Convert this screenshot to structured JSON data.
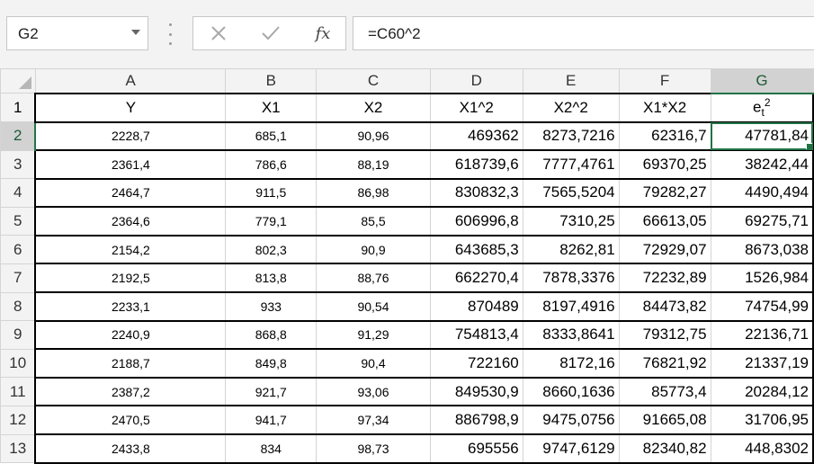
{
  "formula_bar": {
    "name_box": "G2",
    "formula": "=C60^2",
    "cancel_icon": "close-icon",
    "enter_icon": "check-icon",
    "fx_label": "fx"
  },
  "columns": [
    "A",
    "B",
    "C",
    "D",
    "E",
    "F",
    "G"
  ],
  "selected_column": "G",
  "selected_row": "2",
  "row_numbers": [
    "1",
    "2",
    "3",
    "4",
    "5",
    "6",
    "7",
    "8",
    "9",
    "10",
    "11",
    "12",
    "13"
  ],
  "headers": {
    "A": "Y",
    "B": "X1",
    "C": "X2",
    "D": "X1^2",
    "E": "X2^2",
    "F": "X1*X2",
    "G_base": "e",
    "G_sub": "t",
    "G_sup": "2"
  },
  "rows": [
    [
      "2228,7",
      "685,1",
      "90,96",
      "469362",
      "8273,7216",
      "62316,7",
      "47781,84"
    ],
    [
      "2361,4",
      "786,6",
      "88,19",
      "618739,6",
      "7777,4761",
      "69370,25",
      "38242,44"
    ],
    [
      "2464,7",
      "911,5",
      "86,98",
      "830832,3",
      "7565,5204",
      "79282,27",
      "4490,494"
    ],
    [
      "2364,6",
      "779,1",
      "85,5",
      "606996,8",
      "7310,25",
      "66613,05",
      "69275,71"
    ],
    [
      "2154,2",
      "802,3",
      "90,9",
      "643685,3",
      "8262,81",
      "72929,07",
      "8673,038"
    ],
    [
      "2192,5",
      "813,8",
      "88,76",
      "662270,4",
      "7878,3376",
      "72232,89",
      "1526,984"
    ],
    [
      "2233,1",
      "933",
      "90,54",
      "870489",
      "8197,4916",
      "84473,82",
      "74754,99"
    ],
    [
      "2240,9",
      "868,8",
      "91,29",
      "754813,4",
      "8333,8641",
      "79312,75",
      "22136,71"
    ],
    [
      "2188,7",
      "849,8",
      "90,4",
      "722160",
      "8172,16",
      "76821,92",
      "21337,19"
    ],
    [
      "2387,2",
      "921,7",
      "93,06",
      "849530,9",
      "8660,1636",
      "85773,4",
      "20284,12"
    ],
    [
      "2470,5",
      "941,7",
      "97,34",
      "886798,9",
      "9475,0756",
      "91665,08",
      "31706,95"
    ],
    [
      "2433,8",
      "834",
      "98,73",
      "695556",
      "9747,6129",
      "82340,82",
      "448,8302"
    ]
  ],
  "colors": {
    "accent": "#217346",
    "header_bg": "#f3f3f3",
    "gridline": "#d4d4d4"
  }
}
